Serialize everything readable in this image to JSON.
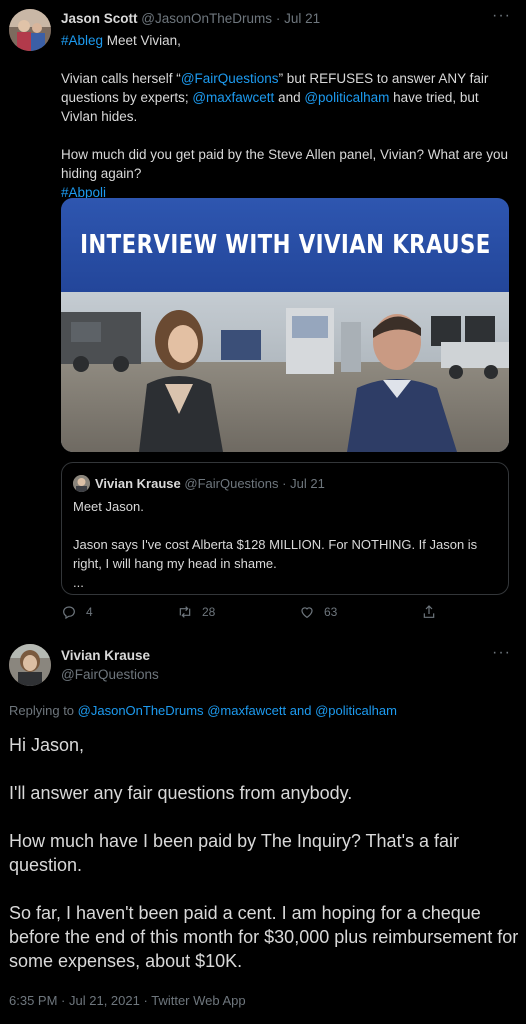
{
  "tweet1": {
    "author_name": "Jason Scott",
    "author_handle": "@JasonOnTheDrums",
    "time": "Jul 21",
    "hashtag1": "#Ableg",
    "line1_rest": " Meet Vivian,",
    "p2_a": "Vivian calls herself “",
    "p2_mention": "@FairQuestions",
    "p2_b": "” but REFUSES to answer ANY fair questions by experts; ",
    "p2_mention2": "@maxfawcett",
    "p2_c": " and ",
    "p2_mention3": "@politicalham",
    "p2_d": " have tried, but Vivlan hides.",
    "p3": "How much did you get paid by the Steve Allen panel, Vivian?  What are you hiding again?",
    "hashtag2": "#Abpoli",
    "media_banner": "INTERVIEW WITH VIVIAN KRAUSE",
    "quote": {
      "author_name": "Vivian Krause",
      "author_handle": "@FairQuestions",
      "time": "Jul 21",
      "line1": "Meet Jason.",
      "line2": "Jason says I've cost Alberta $128 MILLION. For NOTHING. If Jason is right, I will hang my head in shame.",
      "ellipsis": "..."
    },
    "actions": {
      "replies": "4",
      "retweets": "28",
      "likes": "63"
    }
  },
  "tweet2": {
    "author_name": "Vivian Krause",
    "author_handle": "@FairQuestions",
    "replying_prefix": "Replying to ",
    "replying_mention1": "@JasonOnTheDrums",
    "replying_mention2": "@maxfawcett",
    "replying_and": " and ",
    "replying_mention3": "@politicalham",
    "p1": "Hi Jason,",
    "p2": "I'll answer any fair questions from anybody.",
    "p3": "How much have I been paid by The Inquiry? That's a fair question.",
    "p4": "So far, I haven't been paid a cent. I am hoping for a cheque before the end of this month for $30,000 plus reimbursement for some expenses, about $10K.",
    "time": "6:35 PM",
    "date": "Jul 21, 2021",
    "source": "Twitter Web App"
  },
  "colors": {
    "background": "#000000",
    "text": "#d9d9d9",
    "link": "#1d9bf0",
    "muted": "#6e767d",
    "banner": "#2e56b0"
  }
}
